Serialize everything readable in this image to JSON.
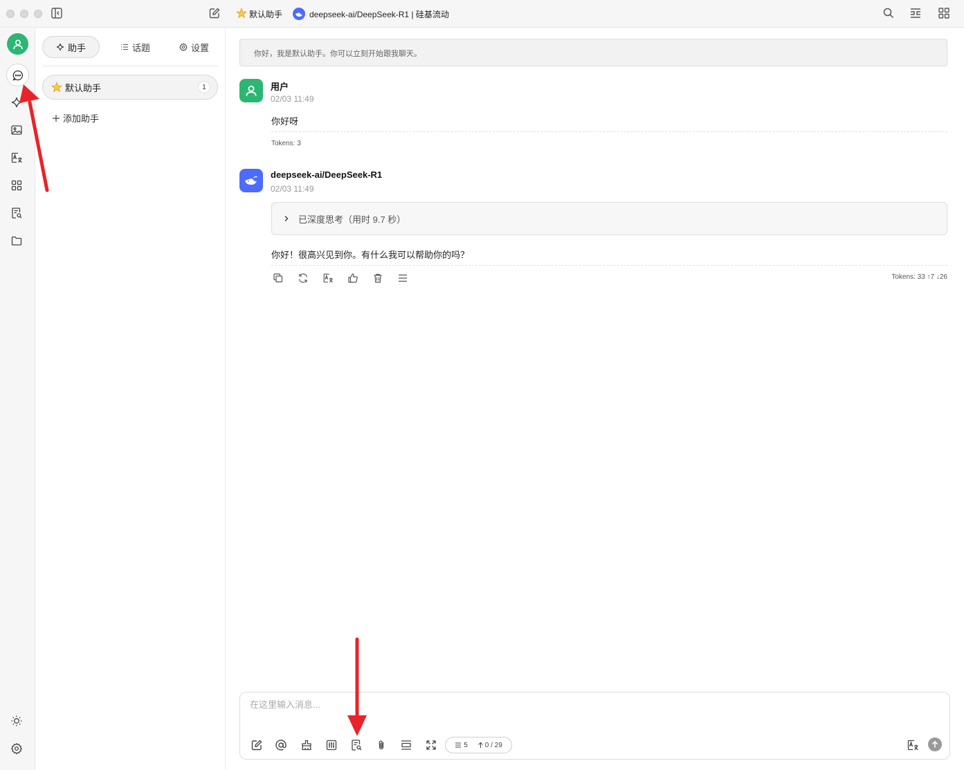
{
  "titlebar": {
    "assistant_label": "默认助手",
    "model_label": "deepseek-ai/DeepSeek-R1 | 硅基流动"
  },
  "sidebar": {
    "tabs": [
      {
        "label": "助手",
        "icon": "sparkle-icon"
      },
      {
        "label": "话题",
        "icon": "list-icon"
      },
      {
        "label": "设置",
        "icon": "gear-icon"
      }
    ],
    "assistants": [
      {
        "label": "默认助手",
        "count": "1"
      }
    ],
    "add_label": "添加助手"
  },
  "chat": {
    "greeting": "你好，我是默认助手。你可以立刻开始跟我聊天。",
    "messages": [
      {
        "author": "用户",
        "time": "02/03 11:49",
        "text": "你好呀",
        "tokens": "Tokens: 3"
      },
      {
        "author": "deepseek-ai/DeepSeek-R1",
        "time": "02/03 11:49",
        "thinking": "已深度思考（用时 9.7 秒）",
        "text": "你好！很高兴见到你。有什么我可以帮助你的吗？",
        "tokens": "Tokens: 33 ↑7 ↓26"
      }
    ]
  },
  "composer": {
    "placeholder": "在这里输入消息...",
    "context_count": "5",
    "token_count": "0 / 29"
  },
  "colors": {
    "user_avatar": "#2bb673",
    "model_avatar": "#4d6bfe",
    "annotation_arrow": "#e8232a"
  }
}
